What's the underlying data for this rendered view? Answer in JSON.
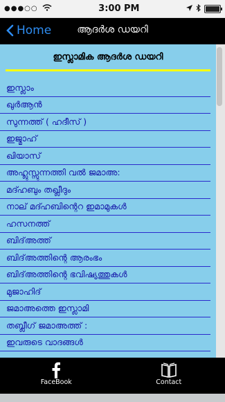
{
  "status": {
    "signal": "●●●○○",
    "time": "3:00 PM"
  },
  "nav": {
    "back_label": "Home",
    "title": "ആദർശ ഡയറി"
  },
  "header": {
    "title": "ഇസ്ലാമിക ആദർശ ഡയറി"
  },
  "list": [
    "ഇസ്ലാം",
    "ഖുർആൻ",
    "സുന്നത്ത് ( ഹദീസ് )",
    "ഇജ്മാഹ്",
    "ഖിയാസ്",
    "അഹ്ലുസ്സുന്നത്തി വൽ ജമാഅ:",
    "മദ്ഹബും തഖ്ലീദും",
    "നാല് മദ്ഹബിന്റെറ ഇമാമുകൾ",
    "ഹസനത്ത്",
    "ബിദ്അത്ത്",
    "ബിദ്അത്തിന്റെ ആരംഭം",
    "ബിദ്അത്തിന്റെ ഭവിഷ്യത്തുകൾ",
    "മുജാഹിദ്",
    "ജമാഅത്തെ ഇസ്ലാമി",
    "തബ്ലീഗ് ജമാഅത്ത് :",
    "ഇവരുടെ വാദങ്ങൾ"
  ],
  "tabs": {
    "facebook": "FaceBook",
    "contact": "Contact"
  },
  "colors": {
    "content_bg": "#87ceeb",
    "item_text": "#1515a8",
    "divider": "#2a2acc",
    "highlight": "#ffff00",
    "back_accent": "#2e8cf0"
  }
}
